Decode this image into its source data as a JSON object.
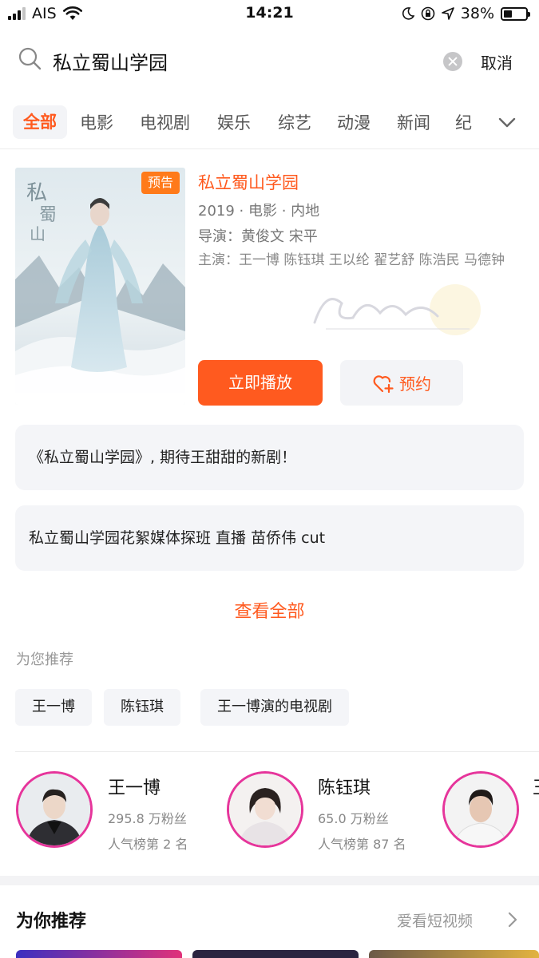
{
  "status_bar": {
    "carrier": "AIS",
    "time": "14:21",
    "battery": "38%",
    "battery_level": 0.38
  },
  "search": {
    "query": "私立蜀山学园",
    "cancel_label": "取消"
  },
  "tabs": [
    "全部",
    "电影",
    "电视剧",
    "娱乐",
    "综艺",
    "动漫",
    "新闻",
    "纪"
  ],
  "movie": {
    "badge": "预告",
    "title": "私立蜀山学园",
    "meta": "2019 · 电影 · 内地",
    "director": "导演：黄俊文  宋平",
    "cast": "主演：王一博  陈钰琪  王以纶  翟艺舒  陈浩民  马德钟",
    "play_label": "立即播放",
    "reserve_label": "预约"
  },
  "related_videos": [
    "《私立蜀山学园》, 期待王甜甜的新剧！",
    "私立蜀山学园花絮媒体探班 直播 苗侨伟 cut"
  ],
  "view_all_label": "查看全部",
  "recommend_for_you": {
    "label": "为您推荐",
    "tags": [
      "王一博",
      "陈钰琪",
      "王一博演的电视剧"
    ]
  },
  "stars": [
    {
      "name": "王一博",
      "fans": "295.8 万粉丝",
      "rank": "人气榜第 2 名"
    },
    {
      "name": "陈钰琪",
      "fans": "65.0 万粉丝",
      "rank": "人气榜第 87 名"
    },
    {
      "name": "王"
    }
  ],
  "bottom_section": {
    "title": "为你推荐",
    "link_label": "爱看短视频"
  },
  "colors": {
    "accent": "#ff5a1f",
    "badge": "#ff7a1a",
    "avatar_ring": "#e6359b",
    "card_bg": "#f4f5f8"
  }
}
